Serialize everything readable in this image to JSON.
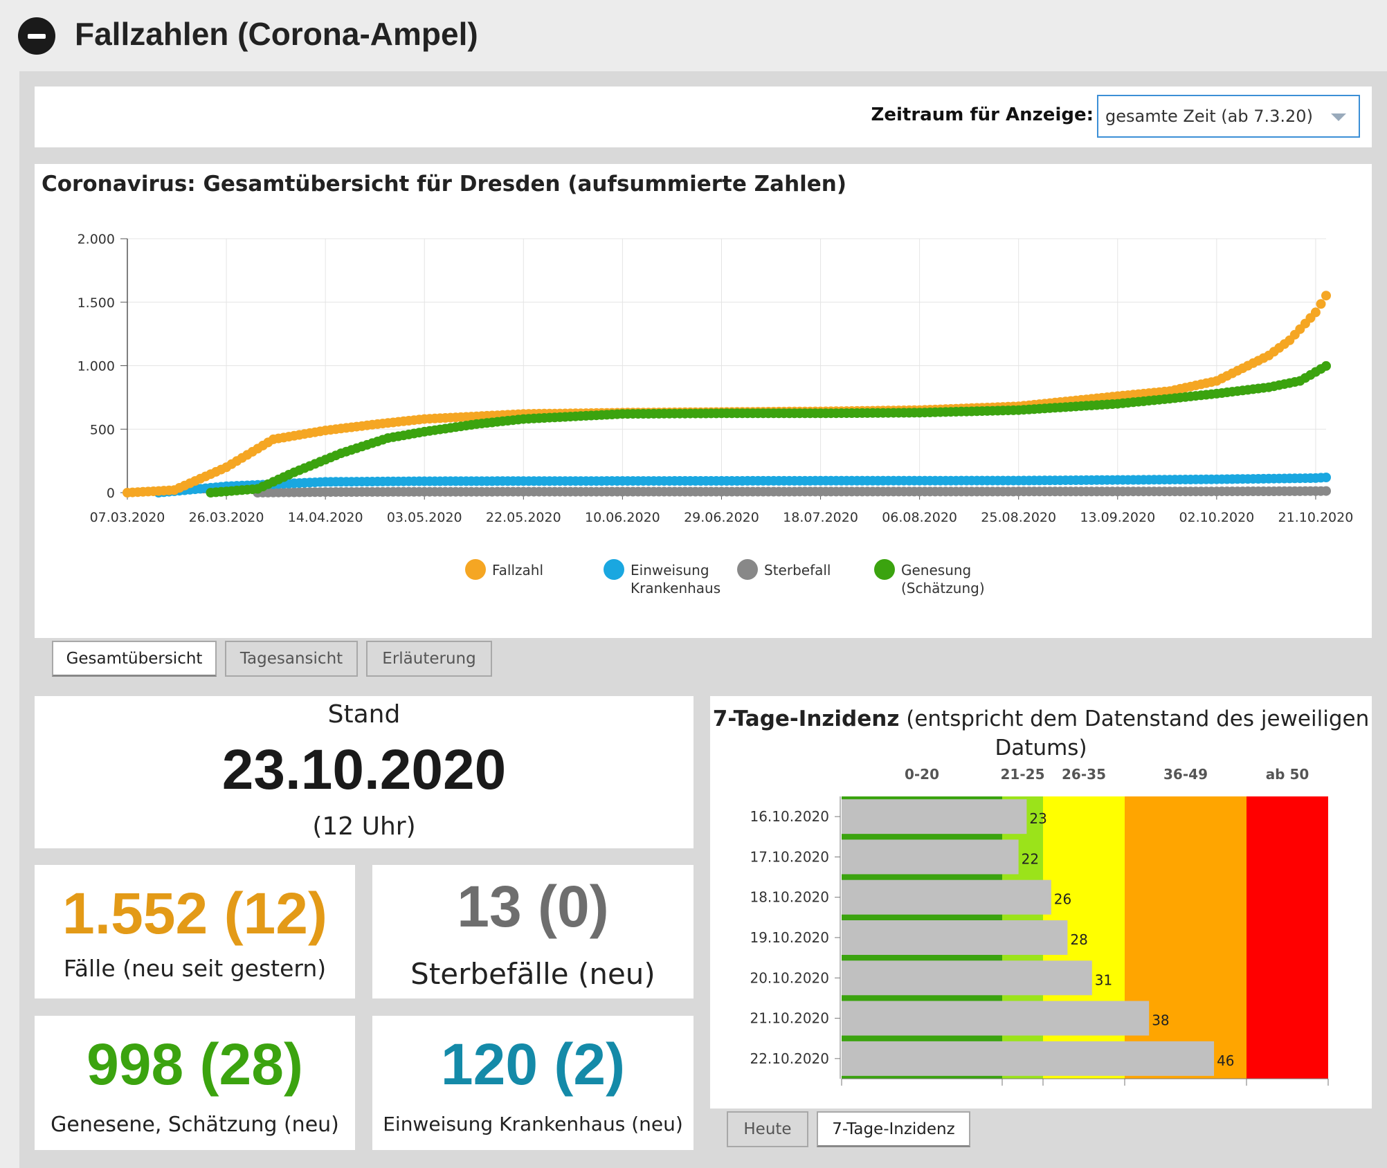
{
  "header": {
    "title": "Fallzahlen (Corona-Ampel)",
    "collapse_icon": "minus-circle-icon"
  },
  "filter": {
    "label": "Zeitraum für Anzeige:",
    "selected": "gesamte Zeit (ab 7.3.20)"
  },
  "chart_data": [
    {
      "type": "scatter",
      "title": "Coronavirus: Gesamtübersicht für Dresden (aufsummierte Zahlen)",
      "x_tick_labels": [
        "07.03.2020",
        "26.03.2020",
        "14.04.2020",
        "03.05.2020",
        "22.05.2020",
        "10.06.2020",
        "29.06.2020",
        "18.07.2020",
        "06.08.2020",
        "25.08.2020",
        "13.09.2020",
        "02.10.2020",
        "21.10.2020"
      ],
      "y_tick_labels": [
        "0",
        "500",
        "1.000",
        "1.500",
        "2.000"
      ],
      "ylim": [
        0,
        2000
      ],
      "x_range": [
        "07.03.2020",
        "23.10.2020"
      ],
      "grid": true,
      "legend_position": "bottom",
      "series": [
        {
          "name": "Fallzahl",
          "color": "#f5a623",
          "points": [
            [
              "07.03.2020",
              0
            ],
            [
              "16.03.2020",
              20
            ],
            [
              "26.03.2020",
              200
            ],
            [
              "04.04.2020",
              420
            ],
            [
              "14.04.2020",
              490
            ],
            [
              "24.04.2020",
              540
            ],
            [
              "03.05.2020",
              580
            ],
            [
              "22.05.2020",
              620
            ],
            [
              "10.06.2020",
              630
            ],
            [
              "29.06.2020",
              635
            ],
            [
              "18.07.2020",
              640
            ],
            [
              "06.08.2020",
              650
            ],
            [
              "25.08.2020",
              680
            ],
            [
              "13.09.2020",
              760
            ],
            [
              "23.09.2020",
              800
            ],
            [
              "02.10.2020",
              880
            ],
            [
              "12.10.2020",
              1080
            ],
            [
              "16.10.2020",
              1200
            ],
            [
              "21.10.2020",
              1420
            ],
            [
              "23.10.2020",
              1552
            ]
          ]
        },
        {
          "name": "Einweisung Krankenhaus",
          "color": "#1aa7e0",
          "points": [
            [
              "13.03.2020",
              0
            ],
            [
              "26.03.2020",
              50
            ],
            [
              "14.04.2020",
              85
            ],
            [
              "03.05.2020",
              90
            ],
            [
              "10.06.2020",
              92
            ],
            [
              "25.08.2020",
              95
            ],
            [
              "13.09.2020",
              100
            ],
            [
              "02.10.2020",
              105
            ],
            [
              "21.10.2020",
              115
            ],
            [
              "23.10.2020",
              120
            ]
          ]
        },
        {
          "name": "Sterbefall",
          "color": "#888888",
          "points": [
            [
              "01.04.2020",
              0
            ],
            [
              "14.04.2020",
              5
            ],
            [
              "03.05.2020",
              7
            ],
            [
              "10.06.2020",
              8
            ],
            [
              "25.08.2020",
              9
            ],
            [
              "02.10.2020",
              10
            ],
            [
              "21.10.2020",
              12
            ],
            [
              "23.10.2020",
              13
            ]
          ]
        },
        {
          "name": "Genesung (Schätzung)",
          "color": "#3ba30f",
          "points": [
            [
              "23.03.2020",
              0
            ],
            [
              "01.04.2020",
              30
            ],
            [
              "08.04.2020",
              160
            ],
            [
              "17.04.2020",
              310
            ],
            [
              "26.04.2020",
              430
            ],
            [
              "03.05.2020",
              480
            ],
            [
              "13.05.2020",
              540
            ],
            [
              "22.05.2020",
              580
            ],
            [
              "10.06.2020",
              620
            ],
            [
              "29.06.2020",
              625
            ],
            [
              "18.07.2020",
              625
            ],
            [
              "06.08.2020",
              630
            ],
            [
              "25.08.2020",
              650
            ],
            [
              "13.09.2020",
              700
            ],
            [
              "23.09.2020",
              740
            ],
            [
              "02.10.2020",
              780
            ],
            [
              "12.10.2020",
              830
            ],
            [
              "18.10.2020",
              880
            ],
            [
              "23.10.2020",
              998
            ]
          ]
        }
      ]
    },
    {
      "type": "bar",
      "orientation": "horizontal",
      "categories": [
        "16.10.2020",
        "17.10.2020",
        "18.10.2020",
        "19.10.2020",
        "20.10.2020",
        "21.10.2020",
        "22.10.2020"
      ],
      "values": [
        23,
        22,
        26,
        28,
        31,
        38,
        46
      ],
      "bar_color": "#c0c0c0",
      "xlim": [
        0,
        50
      ],
      "zones": [
        {
          "label": "0-20",
          "from": 0,
          "to": 20,
          "color": "#3ba30f"
        },
        {
          "label": "21-25",
          "from": 20,
          "to": 25,
          "color": "#9be31a"
        },
        {
          "label": "26-35",
          "from": 25,
          "to": 35,
          "color": "#ffff00"
        },
        {
          "label": "36-49",
          "from": 35,
          "to": 50,
          "color": "#ffa500"
        },
        {
          "label": "ab 50",
          "from": 50,
          "to": 60,
          "color": "#ff0000"
        }
      ]
    }
  ],
  "tabs_main": [
    {
      "label": "Gesamtübersicht",
      "active": true
    },
    {
      "label": "Tagesansicht",
      "active": false
    },
    {
      "label": "Erläuterung",
      "active": false
    }
  ],
  "stand": {
    "label": "Stand",
    "date": "23.10.2020",
    "time": "(12 Uhr)"
  },
  "stats": {
    "faelle": {
      "value": "1.552 (12)",
      "label": "Fälle (neu seit gestern)",
      "color": "#e39a17"
    },
    "sterbefaelle": {
      "value": "13 (0)",
      "label": "Sterbefälle (neu)",
      "color": "#6e6e6e"
    },
    "genesene": {
      "value": "998 (28)",
      "label": "Genesene, Schätzung (neu)",
      "color": "#3ba30f"
    },
    "krankenhaus": {
      "value": "120 (2)",
      "label": "Einweisung Krankenhaus (neu)",
      "color": "#148aa8"
    }
  },
  "inzidenz": {
    "title_bold": "7-Tage-Inzidenz",
    "title_rest": " (entspricht dem Datenstand des jeweiligen Datums)"
  },
  "tabs_inzidenz": [
    {
      "label": "Heute",
      "active": false
    },
    {
      "label": "7-Tage-Inzidenz",
      "active": true
    }
  ]
}
